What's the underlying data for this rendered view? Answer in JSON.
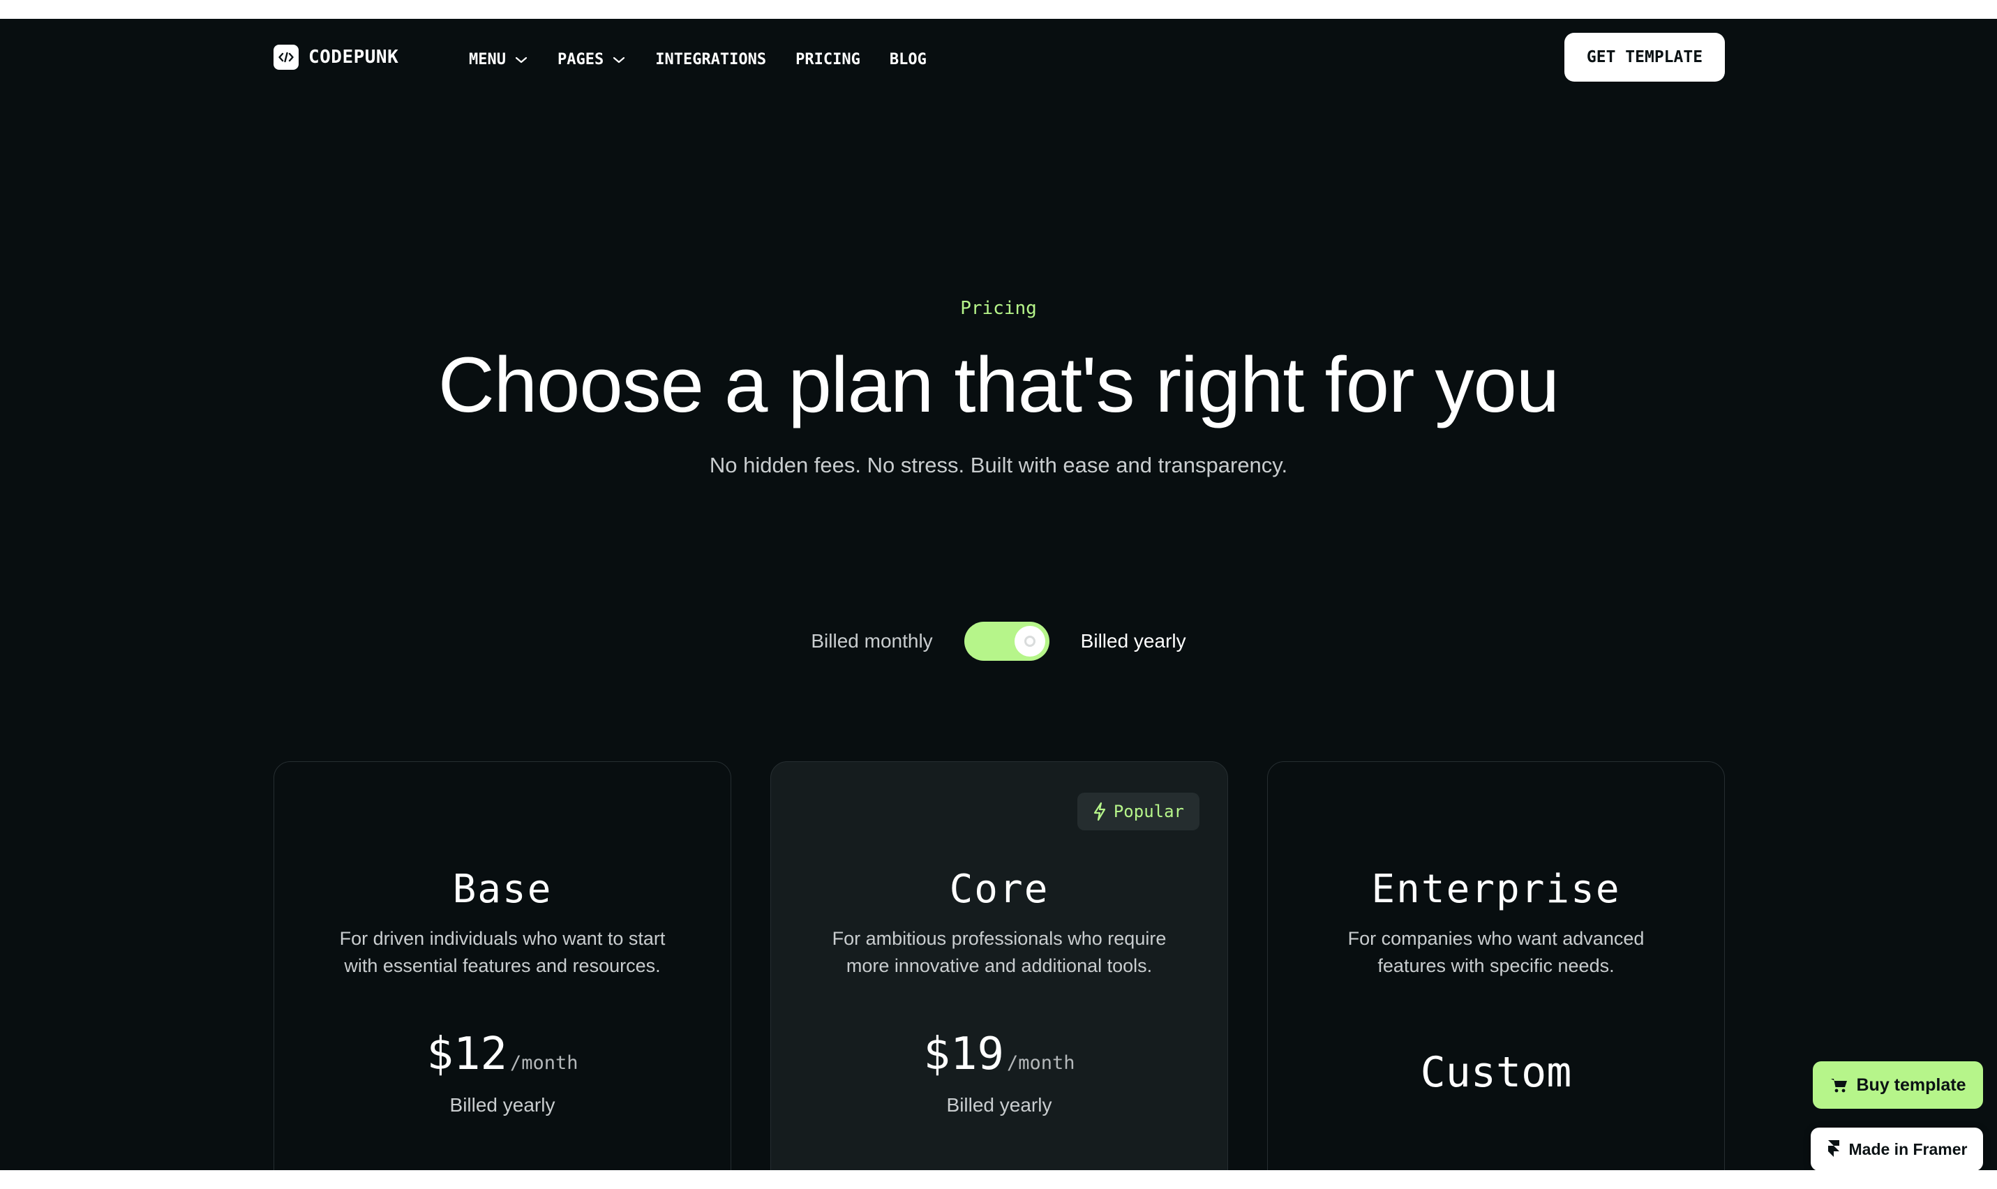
{
  "brand": {
    "name": "CODEPUNK",
    "logo_icon": "code-icon"
  },
  "nav": {
    "items": [
      {
        "label": "MENU",
        "has_dropdown": true
      },
      {
        "label": "PAGES",
        "has_dropdown": true
      },
      {
        "label": "INTEGRATIONS",
        "has_dropdown": false
      },
      {
        "label": "PRICING",
        "has_dropdown": false
      },
      {
        "label": "BLOG",
        "has_dropdown": false
      }
    ],
    "cta_label": "GET TEMPLATE"
  },
  "hero": {
    "eyebrow": "Pricing",
    "title": "Choose a plan that's right for you",
    "subtitle": "No hidden fees. No stress. Built with ease and transparency."
  },
  "billing": {
    "monthly_label": "Billed monthly",
    "yearly_label": "Billed yearly",
    "selected": "yearly"
  },
  "plans": [
    {
      "name": "Base",
      "description_line1": "For driven individuals who want to start",
      "description_line2": "with essential features and resources.",
      "price": "$12",
      "period": "/month",
      "billing_note": "Billed yearly"
    },
    {
      "name": "Core",
      "badge": "Popular",
      "badge_icon": "lightning-icon",
      "description_line1": "For ambitious professionals who require",
      "description_line2": "more innovative and additional tools.",
      "price": "$19",
      "period": "/month",
      "billing_note": "Billed yearly"
    },
    {
      "name": "Enterprise",
      "description_line1": "For companies who want advanced",
      "description_line2": "features with specific needs.",
      "price": "Custom"
    }
  ],
  "floating": {
    "buy_label": "Buy template",
    "buy_icon": "cart-icon",
    "framer_label": "Made in Framer",
    "framer_icon": "framer-icon"
  },
  "colors": {
    "background": "#080e10",
    "accent": "#b6f58a",
    "card_featured": "#151c1e",
    "text": "#ffffff",
    "muted_text": "#c9cdcf"
  }
}
